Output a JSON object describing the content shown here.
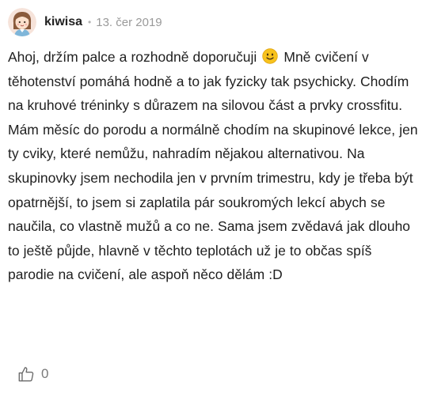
{
  "comment": {
    "author": "kiwisa",
    "separator": "•",
    "date": "13. čer 2019",
    "avatar_icon": "girl-avatar-icon",
    "text_before_emoji": "Ahoj, držím palce a rozhodně doporučuji",
    "emoji_icon": "slightly-smiling-face-emoji",
    "text_after_emoji": "Mně cvičení v těhotenství pomáhá hodně a to jak fyzicky tak psychicky. Chodím na kruhové tréninky s důrazem na silovou část a prvky crossfitu. Mám měsíc do porodu a normálně chodím na skupinové lekce, jen ty cviky, které nemůžu, nahradím nějakou alternativou. Na skupinovky jsem nechodila jen v prvním trimestru, kdy je třeba být opatrnější, to jsem si zaplatila pár soukromých lekcí abych se naučila, co vlastně mužů a co ne. Sama jsem zvědavá jak dlouho to ještě půjde, hlavně v těchto teplotách už je to občas spíš parodie na cvičení, ale aspoň něco dělám :D",
    "like_icon": "thumbs-up-icon",
    "like_count": "0"
  },
  "colors": {
    "text": "#1f1f1f",
    "muted": "#9a9a9a",
    "emoji_face": "#f7c21d",
    "avatar_bg": "#f3d9cf"
  }
}
